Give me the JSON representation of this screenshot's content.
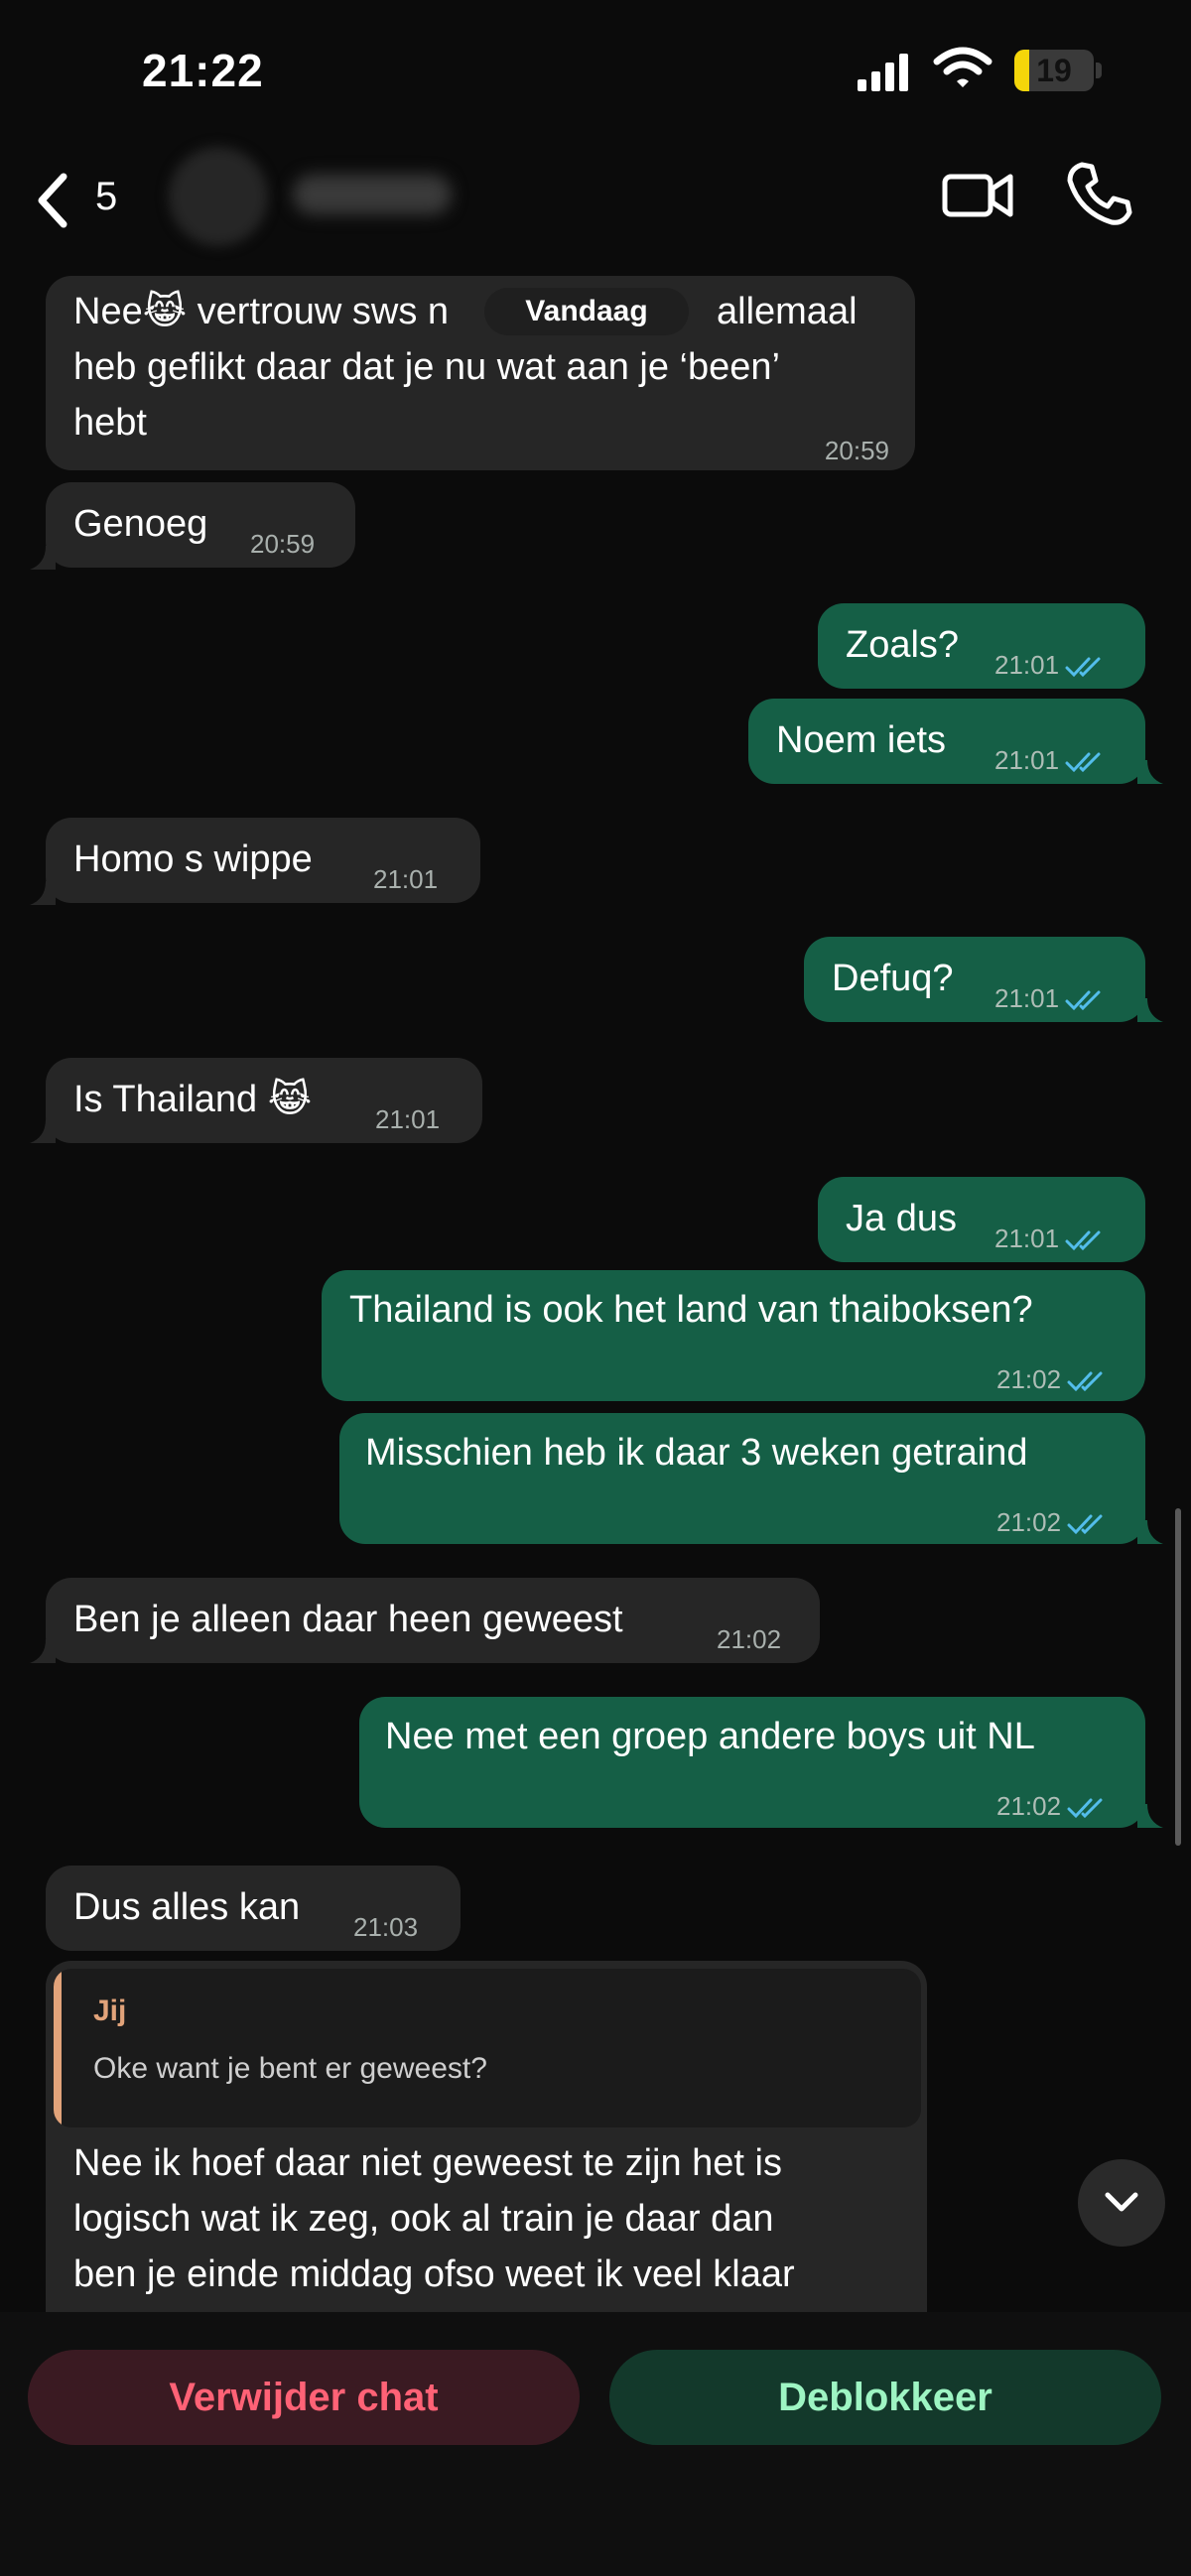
{
  "status_bar": {
    "time": "21:22",
    "battery": "19",
    "battery_level": 0.19
  },
  "header": {
    "back_count": "5",
    "contact_name": "",
    "icons": [
      "chevron-left-icon",
      "video-camera-icon",
      "phone-icon"
    ]
  },
  "date_separator": "Vandaag",
  "messages": [
    {
      "dir": "in",
      "lines": [
        "Nee😹 vertrouw sws n",
        "heb geflikt daar dat je nu wat aan je ‘been’",
        "hebt"
      ],
      "line1_after": "allemaal",
      "time": "20:59"
    },
    {
      "dir": "in",
      "text": "Genoeg",
      "time": "20:59"
    },
    {
      "dir": "out",
      "text": "Zoals?",
      "time": "21:01"
    },
    {
      "dir": "out",
      "text": "Noem iets",
      "time": "21:01"
    },
    {
      "dir": "in",
      "text": "Homo s wippe",
      "time": "21:01"
    },
    {
      "dir": "out",
      "text": "Defuq?",
      "time": "21:01"
    },
    {
      "dir": "in",
      "text": "Is Thailand 😹",
      "time": "21:01"
    },
    {
      "dir": "out",
      "text": "Ja dus",
      "time": "21:01"
    },
    {
      "dir": "out",
      "text": "Thailand is ook het land van thaiboksen?",
      "time": "21:02"
    },
    {
      "dir": "out",
      "text": "Misschien heb ik daar 3 weken getraind",
      "time": "21:02"
    },
    {
      "dir": "in",
      "text": "Ben je alleen daar heen geweest",
      "time": "21:02"
    },
    {
      "dir": "out",
      "text": "Nee met een groep andere boys uit NL",
      "time": "21:02"
    },
    {
      "dir": "in",
      "text": "Dus alles kan",
      "time": "21:03"
    },
    {
      "dir": "in",
      "quote_author": "Jij",
      "quote_text": "Oke want je bent er geweest?",
      "lines": [
        "Nee ik hoef daar niet geweest te zijn het is",
        "logisch wat ik zeg, ook al train je daar dan",
        "ben je einde middag ofso weet ik veel klaar"
      ]
    }
  ],
  "footer": {
    "delete_label": "Verwijder chat",
    "unblock_label": "Deblokkeer"
  },
  "colors": {
    "incoming": "#262626",
    "outgoing": "#155f46",
    "tick_read": "#53bdeb",
    "delete": "#ff6276",
    "unblock": "#9ef5c3"
  }
}
